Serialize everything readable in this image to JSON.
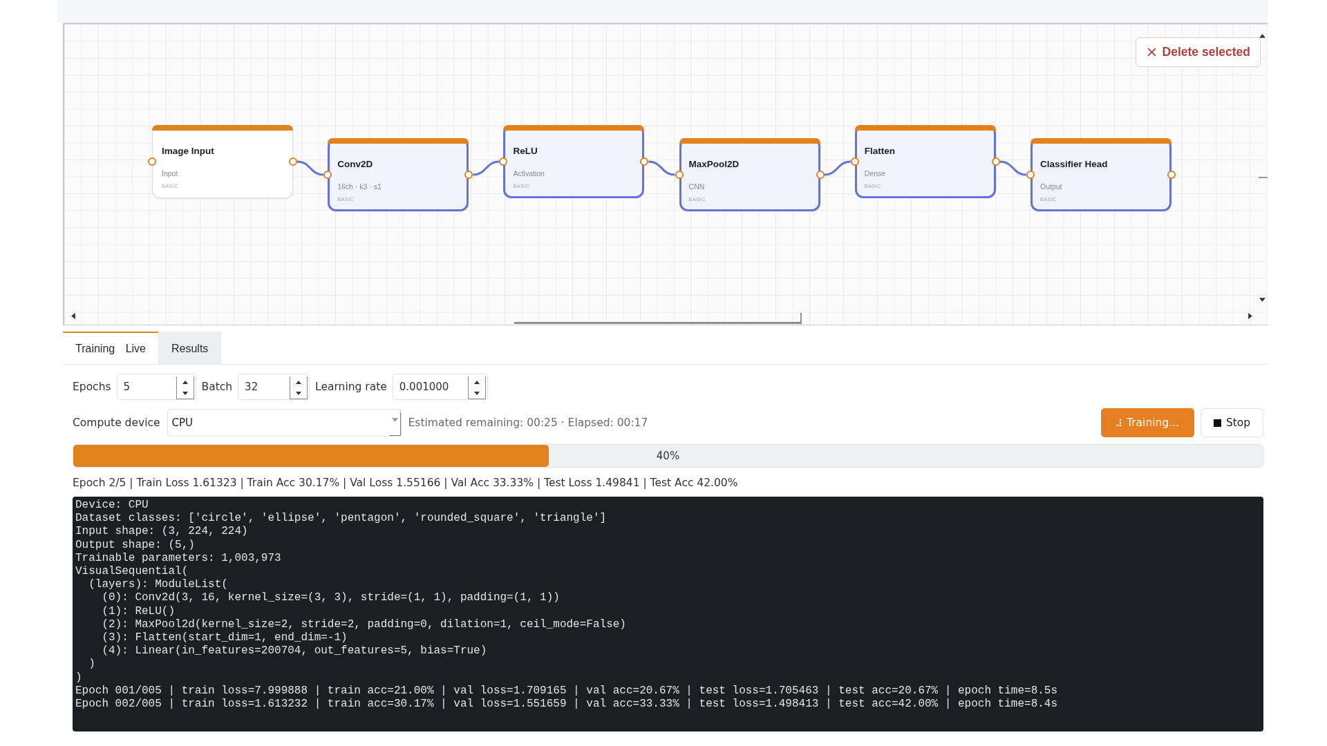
{
  "canvas": {
    "delete_button": "Delete selected",
    "nodes": [
      {
        "title": "Image Input",
        "subtitle": "Input",
        "tag": "BASIC",
        "selected": false
      },
      {
        "title": "Conv2D",
        "subtitle": "16ch · k3 · s1",
        "tag": "BASIC",
        "selected": true
      },
      {
        "title": "ReLU",
        "subtitle": "Activation",
        "tag": "BASIC",
        "selected": true
      },
      {
        "title": "MaxPool2D",
        "subtitle": "CNN",
        "tag": "BASIC",
        "selected": true
      },
      {
        "title": "Flatten",
        "subtitle": "Dense",
        "tag": "BASIC",
        "selected": true
      },
      {
        "title": "Classifier Head",
        "subtitle": "Output",
        "tag": "BASIC",
        "selected": true
      }
    ]
  },
  "tabs": [
    {
      "label": "Training Live",
      "selected": true
    },
    {
      "label": "Results",
      "selected": false
    }
  ],
  "params": [
    {
      "label": "Epochs",
      "value": "5"
    },
    {
      "label": "Batch",
      "value": "32"
    },
    {
      "label": "Learning rate",
      "value": "0.001000"
    }
  ],
  "device": {
    "label": "Compute device",
    "value": "CPU"
  },
  "timing": "Estimated remaining: 00:25 · Elapsed: 00:17",
  "actions": [
    {
      "label": "Training...",
      "kind": "busy"
    },
    {
      "label": "Stop",
      "kind": "stop"
    }
  ],
  "progress": {
    "level": 0.4,
    "reading": "40%"
  },
  "epoch_summary": "Epoch 2/5 | Train Loss 1.61323 | Train Acc 30.17% | Val Loss 1.55166 | Val Acc 33.33% | Test Loss 1.49841 | Test Acc 42.00%",
  "console": {
    "lines": [
      "Device: CPU",
      "Dataset classes: ['circle', 'ellipse', 'pentagon', 'rounded_square', 'triangle']",
      "Input shape: (3, 224, 224)",
      "Output shape: (5,)",
      "Trainable parameters: 1,003,973",
      "VisualSequential(",
      "  (layers): ModuleList(",
      "    (0): Conv2d(3, 16, kernel_size=(3, 3), stride=(1, 1), padding=(1, 1))",
      "    (1): ReLU()",
      "    (2): MaxPool2d(kernel_size=2, stride=2, padding=0, dilation=1, ceil_mode=False)",
      "    (3): Flatten(start_dim=1, end_dim=-1)",
      "    (4): Linear(in_features=200704, out_features=5, bias=True)",
      "  )",
      ")",
      "Epoch 001/005 | train loss=7.999888 | train acc=21.00% | val loss=1.709165 | val acc=20.67% | test loss=1.705463 | test acc=20.67% | epoch time=8.5s",
      "Epoch 002/005 | train loss=1.613232 | train acc=30.17% | val loss=1.551659 | val acc=33.33% | test loss=1.498413 | test acc=42.00% | epoch time=8.4s"
    ]
  }
}
